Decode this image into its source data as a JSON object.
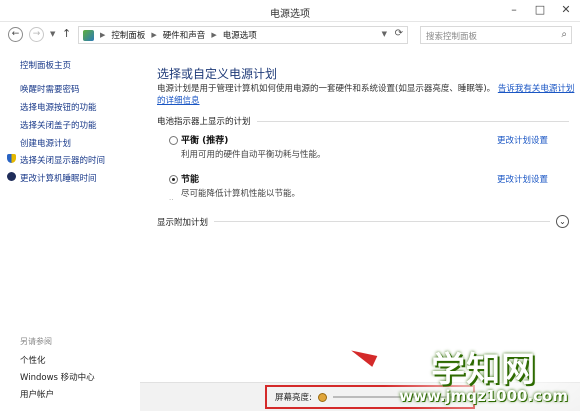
{
  "window": {
    "title": "电源选项"
  },
  "address": {
    "crumbs": [
      "控制面板",
      "硬件和声音",
      "电源选项"
    ],
    "search_placeholder": "搜索控制面板"
  },
  "sidebar": {
    "home": "控制面板主页",
    "items": [
      {
        "label": "唤醒时需要密码",
        "icon": ""
      },
      {
        "label": "选择电源按钮的功能",
        "icon": ""
      },
      {
        "label": "选择关闭盖子的功能",
        "icon": ""
      },
      {
        "label": "创建电源计划",
        "icon": ""
      },
      {
        "label": "选择关闭显示器的时间",
        "icon": "shield-icon"
      },
      {
        "label": "更改计算机睡眠时间",
        "icon": "moon-icon"
      }
    ],
    "see_also": {
      "title": "另请参阅",
      "items": [
        "个性化",
        "Windows 移动中心",
        "用户帐户"
      ]
    }
  },
  "main": {
    "heading": "选择或自定义电源计划",
    "description": "电源计划是用于管理计算机如何使用电源的一套硬件和系统设置(如显示器亮度、睡眠等)。",
    "description_link": "告诉我有关电源计划的详细信息",
    "section_title": "电池指示器上显示的计划",
    "plans": [
      {
        "name": "平衡 (推荐)",
        "desc": "利用可用的硬件自动平衡功耗与性能。",
        "link": "更改计划设置",
        "selected": false
      },
      {
        "name": "节能",
        "desc": "尽可能降低计算机性能以节能。",
        "link": "更改计划设置",
        "selected": true
      }
    ],
    "more_plans": "显示附加计划"
  },
  "bottom": {
    "brightness_label": "屏幕亮度:"
  },
  "watermark": {
    "main": "学知网",
    "sub": "www.jmqz1000.com"
  },
  "colors": {
    "link": "#1a56c4",
    "heading": "#1e3a78",
    "highlight": "#d42a2a"
  }
}
